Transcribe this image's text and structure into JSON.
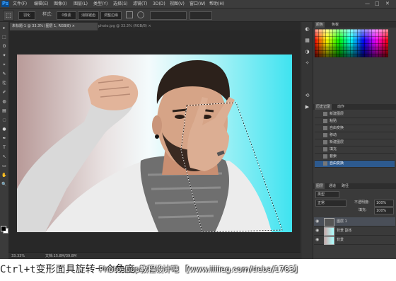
{
  "app": {
    "logo": "Ps",
    "menu": [
      "文件(F)",
      "编辑(E)",
      "图像(I)",
      "图层(L)",
      "类型(Y)",
      "选择(S)",
      "滤镜(T)",
      "3D(D)",
      "视图(V)",
      "窗口(W)",
      "帮助(H)"
    ],
    "window_controls": [
      "—",
      "□",
      "✕"
    ]
  },
  "options_bar": {
    "tool_glyph": "⬚",
    "fields": [
      "羽化",
      "0像素",
      "消除锯齿",
      "调整边缘"
    ],
    "label": "样式:"
  },
  "tabs": [
    {
      "label": "未标题-1 @ 33.3% (图层 1, RGB/8)",
      "active": true,
      "close": "×"
    },
    {
      "label": "photo.jpg @ 33.3% (RGB/8)",
      "active": false,
      "close": "×"
    }
  ],
  "tools": [
    "▸",
    "⬚",
    "ʘ",
    "✦",
    "⌖",
    "✎",
    "⎘",
    "✐",
    "◍",
    "▤",
    "◌",
    "●",
    "✒",
    "T",
    "↖",
    "▭",
    "✋",
    "🔍"
  ],
  "status": {
    "zoom": "33.33%",
    "doc": "文档:15.8M/39.8M"
  },
  "panels": {
    "swatches_tabs": [
      "颜色",
      "色板"
    ],
    "history_tabs": [
      "历史记录",
      "动作"
    ],
    "history": [
      {
        "label": "新建图层"
      },
      {
        "label": "粘贴"
      },
      {
        "label": "自由变换"
      },
      {
        "label": "移动"
      },
      {
        "label": "新建图层"
      },
      {
        "label": "填充"
      },
      {
        "label": "套索"
      },
      {
        "label": "自由变换",
        "active": true
      }
    ],
    "layers_tabs": [
      "图层",
      "通道",
      "路径"
    ],
    "kind_filter": "类型",
    "blend_mode": "正常",
    "opacity_label": "不透明度:",
    "opacity": "100%",
    "fill_label": "填充:",
    "fill": "100%",
    "layers": [
      {
        "name": "图层 1",
        "active": true
      },
      {
        "name": "背景 副本",
        "active": false
      },
      {
        "name": "背景",
        "active": false
      }
    ]
  },
  "caption": {
    "text": "Ctrl+t变形面具旋转一个角度",
    "watermark": "Photoshop教程设计吧 【www.iiiiieg.com/tieba/1783】"
  },
  "colors": {
    "selection": "#2d5a8f",
    "canvas_bg": "#282828"
  }
}
